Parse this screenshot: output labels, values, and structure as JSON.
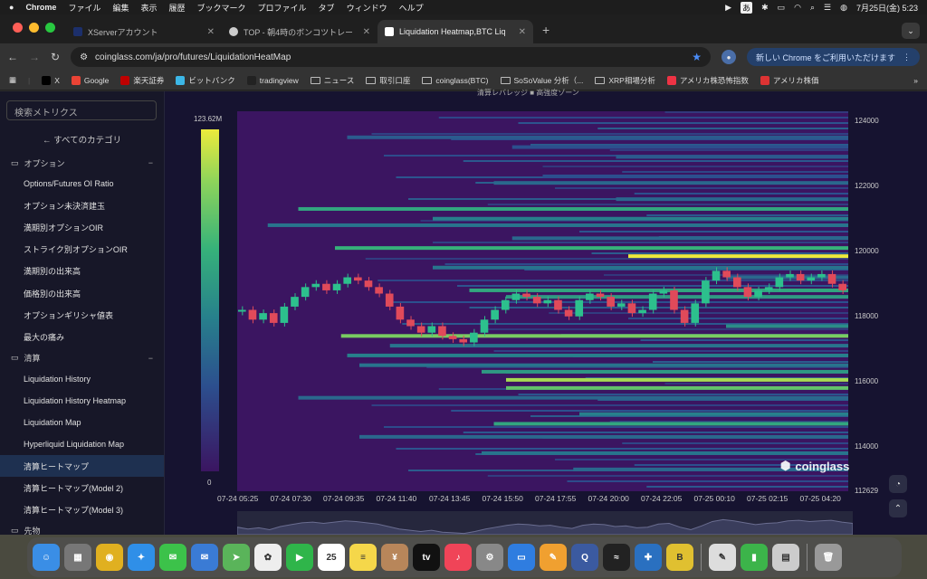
{
  "menubar": {
    "apple": "",
    "app": "Chrome",
    "items": [
      "ファイル",
      "編集",
      "表示",
      "履歴",
      "ブックマーク",
      "プロファイル",
      "タブ",
      "ウィンドウ",
      "ヘルプ"
    ],
    "ime": "あ",
    "datetime": "7月25日(金)  5:23"
  },
  "tabs": [
    {
      "title": "XServerアカウント"
    },
    {
      "title": "TOP - 朝4時のボンコツトレーダー"
    },
    {
      "title": "Liquidation Heatmap,BTC Liq"
    }
  ],
  "toolbar": {
    "url": "coinglass.com/ja/pro/futures/LiquidationHeatMap",
    "update_label": "新しい Chrome をご利用いただけます"
  },
  "bookmarks": [
    {
      "label": "X",
      "color": "#000"
    },
    {
      "label": "Google",
      "color": "#ea4335"
    },
    {
      "label": "楽天証券",
      "color": "#bf0000"
    },
    {
      "label": "ビットバンク",
      "color": "#3cb7e7"
    },
    {
      "label": "tradingview",
      "color": "#222"
    },
    {
      "label": "ニュース",
      "folder": true
    },
    {
      "label": "取引口座",
      "folder": true
    },
    {
      "label": "coinglass(BTC)",
      "folder": true
    },
    {
      "label": "SoSoValue 分析（...",
      "folder": true
    },
    {
      "label": "XRP相場分析",
      "folder": true
    },
    {
      "label": "アメリカ株恐怖指数",
      "color": "#e34"
    },
    {
      "label": "アメリカ株価",
      "color": "#d33"
    }
  ],
  "sidebar": {
    "search_placeholder": "検索メトリクス",
    "all_categories": "すべてのカテゴリ",
    "section_options": "オプション",
    "options_items": [
      "Options/Futures OI Ratio",
      "オプション未決済建玉",
      "満期別オプションOIR",
      "ストライク別オプションOIR",
      "満期別の出来高",
      "価格別の出来高",
      "オプションギリシャ値表",
      "最大の痛み"
    ],
    "section_liq": "清算",
    "liq_items": [
      "Liquidation History",
      "Liquidation History Heatmap",
      "Liquidation Map",
      "Hyperliquid Liquidation Map",
      "清算ヒートマップ",
      "清算ヒートマップ(Model 2)",
      "清算ヒートマップ(Model 3)"
    ],
    "selected": "清算ヒートマップ",
    "section_futures": "先物"
  },
  "chart_data": {
    "type": "heatmap",
    "legend_top": "清算レバレッジ  ■ 高強度ゾーン",
    "scale_max": "123.62M",
    "scale_min": "0",
    "y_ticks": [
      "124000",
      "122000",
      "120000",
      "118000",
      "116000",
      "114000",
      "112629"
    ],
    "x_ticks": [
      "07-24 05:25",
      "07-24 07:30",
      "07-24 09:35",
      "07-24 11:40",
      "07-24 13:45",
      "07-24 15:50",
      "07-24 17:55",
      "07-24 20:00",
      "07-24 22:05",
      "07-25 00:10",
      "07-25 02:15",
      "07-25 04:20"
    ],
    "ylim": [
      112629,
      124300
    ],
    "price": [
      118200,
      117900,
      118100,
      117800,
      118300,
      118600,
      118900,
      119000,
      118800,
      119000,
      119200,
      119100,
      118900,
      118700,
      118300,
      117900,
      117700,
      117500,
      117700,
      117400,
      117300,
      117200,
      117500,
      117900,
      118200,
      118500,
      118700,
      118600,
      118400,
      118500,
      118200,
      118000,
      118500,
      118700,
      118600,
      118300,
      118400,
      118100,
      118200,
      118700,
      118800,
      118200,
      117800,
      118400,
      119100,
      119400,
      119200,
      118900,
      118600,
      118800,
      118900,
      119200,
      119300,
      119100,
      119200,
      119300,
      119000,
      118800
    ],
    "bands": [
      {
        "y": 123500,
        "x0": 0.18,
        "i": 0.25
      },
      {
        "y": 123200,
        "x0": 0.45,
        "i": 0.2
      },
      {
        "y": 122900,
        "x0": 0.62,
        "i": 0.25
      },
      {
        "y": 122300,
        "x0": 0.5,
        "i": 0.2
      },
      {
        "y": 122100,
        "x0": 0.42,
        "i": 0.3
      },
      {
        "y": 121600,
        "x0": 0.62,
        "i": 0.3
      },
      {
        "y": 121300,
        "x0": 0.1,
        "i": 0.55
      },
      {
        "y": 121000,
        "x0": 0.32,
        "i": 0.4
      },
      {
        "y": 120800,
        "x0": 0.05,
        "i": 0.35
      },
      {
        "y": 120400,
        "x0": 0.45,
        "i": 0.3
      },
      {
        "y": 120100,
        "x0": 0.16,
        "i": 0.6
      },
      {
        "y": 119850,
        "x0": 0.64,
        "i": 1.0
      },
      {
        "y": 119500,
        "x0": 0.32,
        "i": 0.35
      },
      {
        "y": 119200,
        "x0": 0.8,
        "i": 0.3
      },
      {
        "y": 118800,
        "x0": 0.38,
        "i": 0.55
      },
      {
        "y": 118600,
        "x0": 0.44,
        "i": 0.5
      },
      {
        "y": 117700,
        "x0": 0.8,
        "i": 0.45
      },
      {
        "y": 117400,
        "x0": 0.17,
        "i": 0.75
      },
      {
        "y": 117100,
        "x0": 0.25,
        "i": 0.35
      },
      {
        "y": 116800,
        "x0": 0.18,
        "i": 0.4
      },
      {
        "y": 116500,
        "x0": 0.2,
        "i": 0.35
      },
      {
        "y": 116300,
        "x0": 0.4,
        "i": 0.5
      },
      {
        "y": 116050,
        "x0": 0.44,
        "i": 0.85
      },
      {
        "y": 115800,
        "x0": 0.44,
        "i": 0.7
      },
      {
        "y": 115500,
        "x0": 0.1,
        "i": 0.3
      },
      {
        "y": 115000,
        "x0": 0.56,
        "i": 0.4
      },
      {
        "y": 114700,
        "x0": 0.42,
        "i": 0.55
      },
      {
        "y": 114300,
        "x0": 0.2,
        "i": 0.3
      },
      {
        "y": 113800,
        "x0": 0.4,
        "i": 0.35
      },
      {
        "y": 113300,
        "x0": 0.55,
        "i": 0.3
      }
    ]
  },
  "watermark": "coinglass",
  "dock": [
    {
      "name": "finder",
      "color": "#3a8ee6",
      "glyph": "☺"
    },
    {
      "name": "launchpad",
      "color": "#777",
      "glyph": "▦"
    },
    {
      "name": "chrome",
      "color": "#e0b020",
      "glyph": "◉"
    },
    {
      "name": "safari",
      "color": "#2f8fe8",
      "glyph": "✦"
    },
    {
      "name": "messages",
      "color": "#3cc24a",
      "glyph": "✉"
    },
    {
      "name": "mail",
      "color": "#3a7bd5",
      "glyph": "✉"
    },
    {
      "name": "maps",
      "color": "#5ab45a",
      "glyph": "➤"
    },
    {
      "name": "photos",
      "color": "#eee",
      "glyph": "✿"
    },
    {
      "name": "facetime",
      "color": "#2fb54a",
      "glyph": "▶"
    },
    {
      "name": "calendar",
      "color": "#fff",
      "glyph": "25"
    },
    {
      "name": "notes",
      "color": "#f5d74a",
      "glyph": "≡"
    },
    {
      "name": "cash",
      "color": "#b8865a",
      "glyph": "¥"
    },
    {
      "name": "appletv",
      "color": "#111",
      "glyph": "tv"
    },
    {
      "name": "music",
      "color": "#f04458",
      "glyph": "♪"
    },
    {
      "name": "settings",
      "color": "#888",
      "glyph": "⚙"
    },
    {
      "name": "keynote",
      "color": "#2f7de0",
      "glyph": "▭"
    },
    {
      "name": "pages",
      "color": "#f0a030",
      "glyph": "✎"
    },
    {
      "name": "quicktime",
      "color": "#3b5aa0",
      "glyph": "Q"
    },
    {
      "name": "stocks",
      "color": "#222",
      "glyph": "≈"
    },
    {
      "name": "metatrader",
      "color": "#2a70c0",
      "glyph": "✚"
    },
    {
      "name": "bitcoin",
      "color": "#e0c030",
      "glyph": "B"
    },
    {
      "name": "textedit",
      "color": "#ddd",
      "glyph": "✎"
    },
    {
      "name": "numbers",
      "color": "#3cb44a",
      "glyph": "▮"
    },
    {
      "name": "preview",
      "color": "#ccc",
      "glyph": "▤"
    },
    {
      "name": "trash",
      "color": "#999",
      "glyph": "🗑"
    }
  ]
}
